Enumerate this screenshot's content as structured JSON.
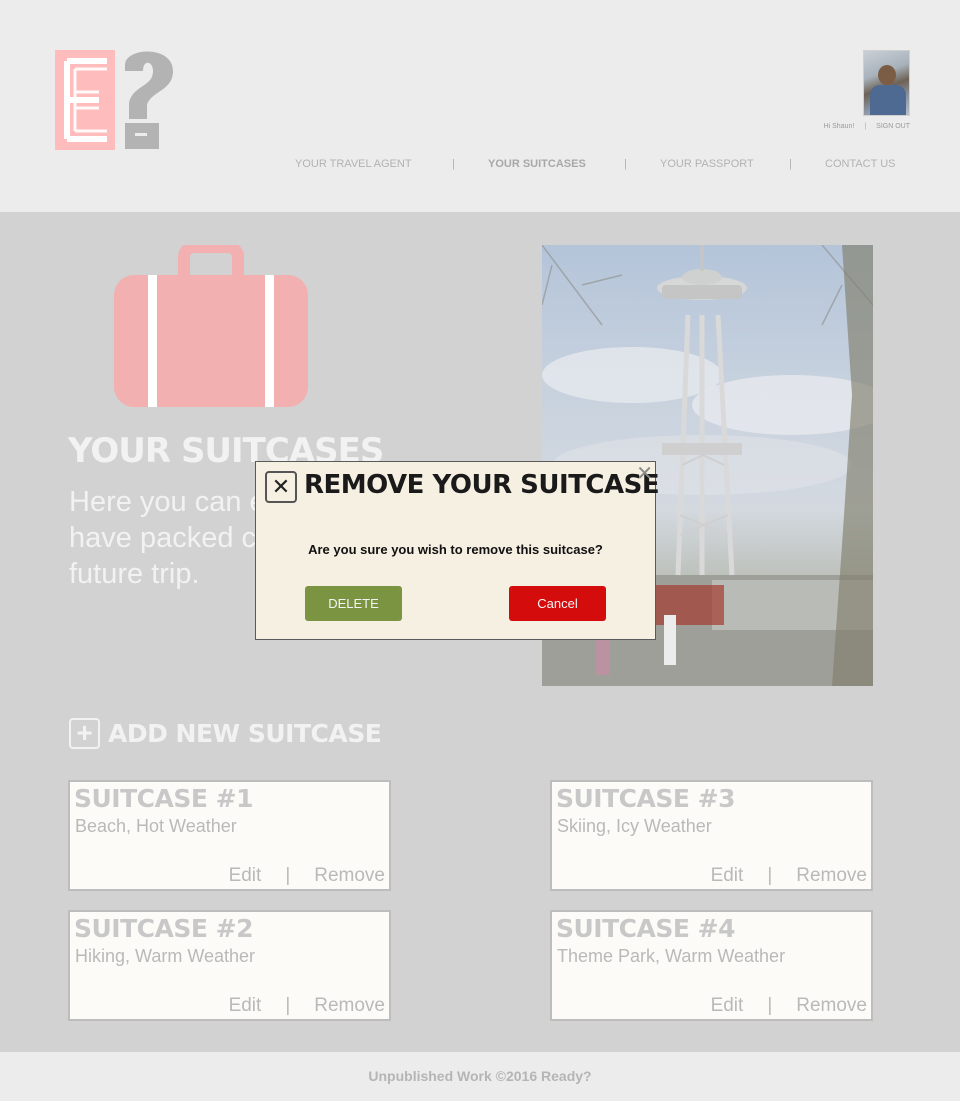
{
  "header": {
    "user": {
      "greeting": "Hi Shaun!",
      "sign_out": "SIGN OUT"
    },
    "nav": [
      {
        "label": "YOUR TRAVEL AGENT",
        "active": false
      },
      {
        "label": "YOUR SUITCASES",
        "active": true
      },
      {
        "label": "YOUR PASSPORT",
        "active": false
      },
      {
        "label": "CONTACT US",
        "active": false
      }
    ],
    "nav_separator": "|"
  },
  "main": {
    "title": "YOUR SUITCASES",
    "intro": "Here you can edit and delete you have packed create new list future trip.",
    "add_new_label": "ADD NEW SUITCASE",
    "add_new_symbol": "+",
    "suitcases": [
      {
        "title": "SUITCASE #1",
        "description": "Beach, Hot Weather",
        "edit": "Edit",
        "remove": "Remove"
      },
      {
        "title": "SUITCASE #2",
        "description": "Hiking, Warm Weather",
        "edit": "Edit",
        "remove": "Remove"
      },
      {
        "title": "SUITCASE #3",
        "description": "Skiing, Icy Weather",
        "edit": "Edit",
        "remove": "Remove"
      },
      {
        "title": "SUITCASE #4",
        "description": "Theme Park, Warm Weather",
        "edit": "Edit",
        "remove": "Remove"
      }
    ],
    "action_separator": "|"
  },
  "modal": {
    "title": "REMOVE YOUR SUITCASE",
    "question": "Are you sure you wish to remove this suitcase?",
    "delete_label": "DELETE",
    "cancel_label": "Cancel",
    "box_close_symbol": "✕",
    "corner_close_symbol": "✕"
  },
  "footer": {
    "text": "Unpublished Work ©2016 Ready?"
  },
  "colors": {
    "logo_pink": "#ffbcbc",
    "logo_gray": "#b3b3b3",
    "suitcase_pink": "#f2b0b0",
    "delete_green": "#7b9442",
    "cancel_red": "#d40c0c",
    "modal_bg": "#f6f0e2"
  },
  "icons": {
    "logo": "e-question-logo",
    "suitcase": "suitcase-icon",
    "photo": "space-needle-photo"
  }
}
